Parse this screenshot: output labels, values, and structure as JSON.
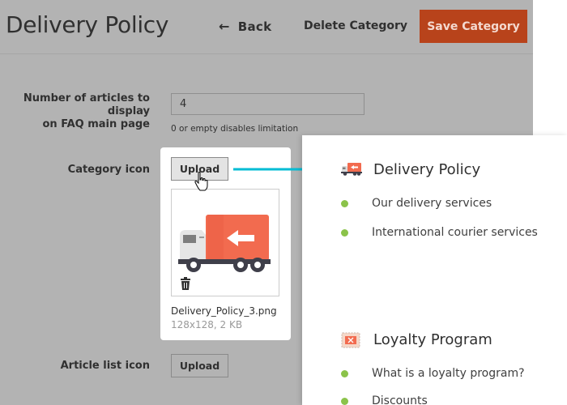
{
  "header": {
    "title": "Delivery Policy",
    "back_label": "Back",
    "delete_label": "Delete Category",
    "save_label": "Save Category"
  },
  "form": {
    "articles_label_line1": "Number of articles to display",
    "articles_label_line2": "on FAQ main page",
    "articles_value": "4",
    "articles_hint": "0 or empty disables limitation",
    "category_icon_label": "Category icon",
    "category_icon_upload": "Upload",
    "category_icon_file": "Delivery_Policy_3.png",
    "category_icon_meta": "128x128, 2 KB",
    "article_list_icon_label": "Article list icon",
    "article_list_icon_upload": "Upload"
  },
  "preview": {
    "categories": [
      {
        "title": "Delivery Policy",
        "icon": "delivery-truck-icon",
        "items": [
          "Our delivery services",
          "International courier services"
        ]
      },
      {
        "title": "Loyalty Program",
        "icon": "loyalty-card-icon",
        "items": [
          "What is a loyalty program?",
          "Discounts"
        ]
      }
    ]
  },
  "colors": {
    "save_button": "#b8431b",
    "bullet": "#8bc34a",
    "connector_arrow": "#00bcd4",
    "truck_cargo": "#f26b4f"
  }
}
